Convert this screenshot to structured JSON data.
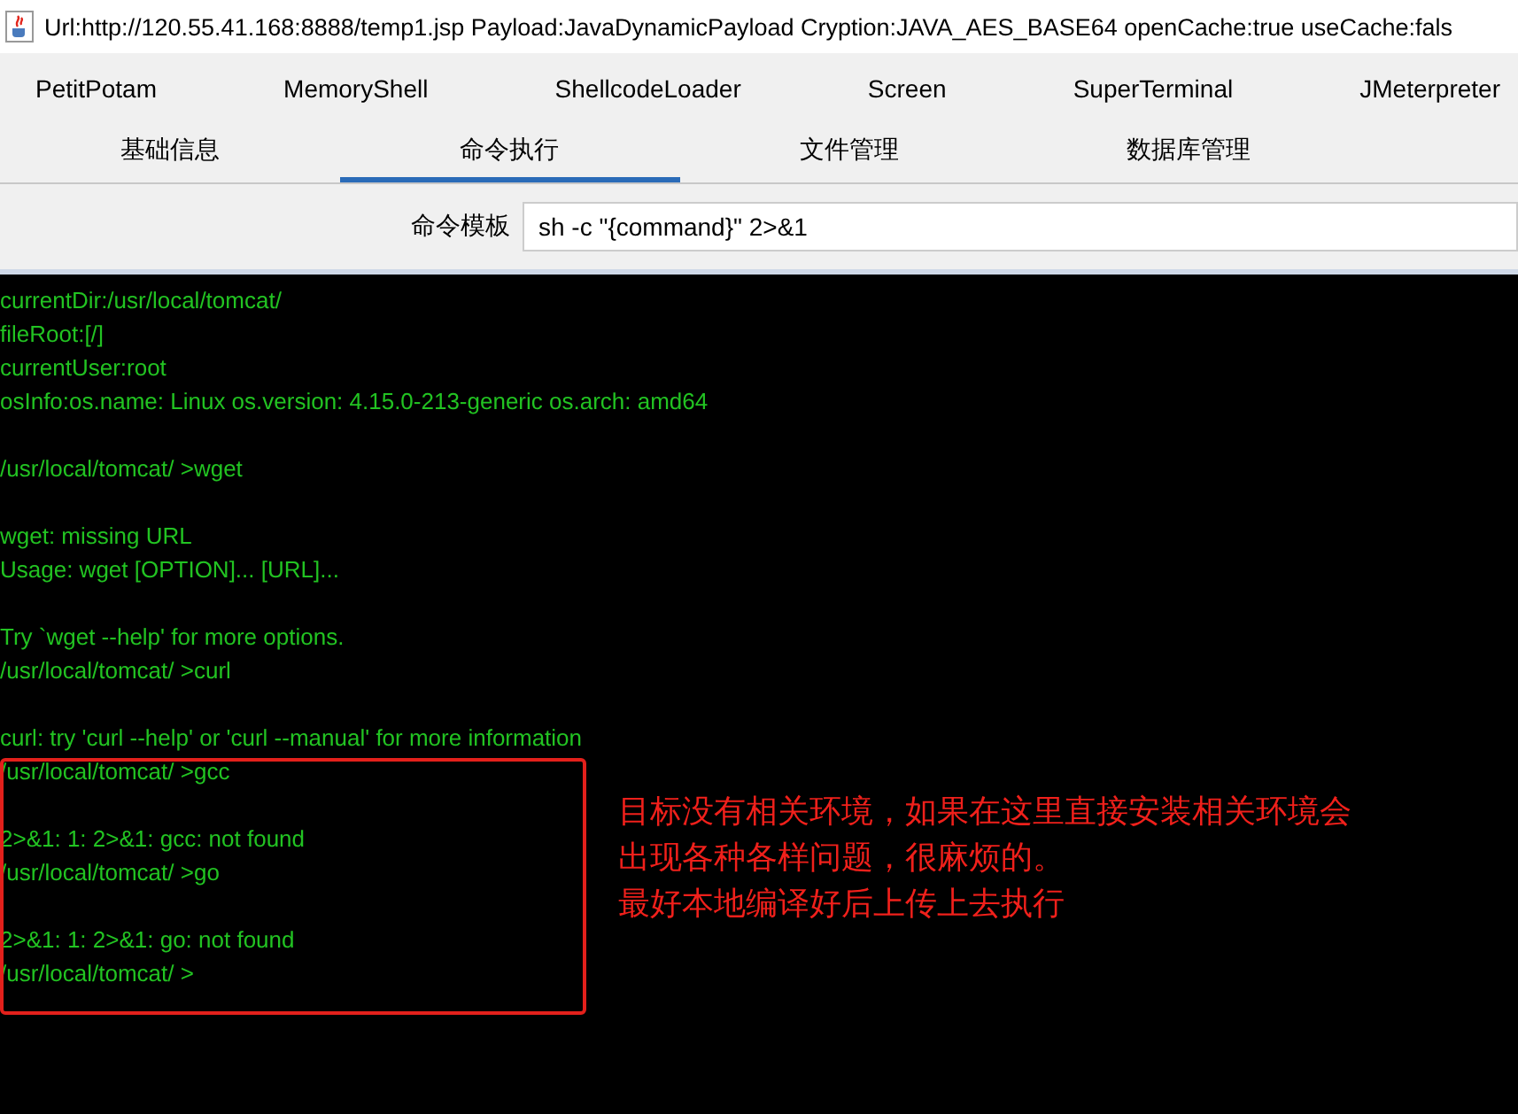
{
  "window": {
    "title": "Url:http://120.55.41.168:8888/temp1.jsp Payload:JavaDynamicPayload Cryption:JAVA_AES_BASE64 openCache:true useCache:fals"
  },
  "plugin_tabs": [
    {
      "label": "PetitPotam"
    },
    {
      "label": "MemoryShell"
    },
    {
      "label": "ShellcodeLoader"
    },
    {
      "label": "Screen"
    },
    {
      "label": "SuperTerminal"
    },
    {
      "label": "JMeterpreter"
    }
  ],
  "tabs": [
    {
      "label": "基础信息",
      "selected": false
    },
    {
      "label": "命令执行",
      "selected": true
    },
    {
      "label": "文件管理",
      "selected": false
    },
    {
      "label": "数据库管理",
      "selected": false
    }
  ],
  "command_template": {
    "label": "命令模板",
    "value": "sh -c \"{command}\" 2>&1"
  },
  "terminal": {
    "blocks": [
      [
        "currentDir:/usr/local/tomcat/",
        "fileRoot:[/]",
        "currentUser:root",
        "osInfo:os.name: Linux os.version: 4.15.0-213-generic os.arch: amd64"
      ],
      [
        "/usr/local/tomcat/ >wget"
      ],
      [
        "wget: missing URL",
        "Usage: wget [OPTION]... [URL]..."
      ],
      [
        "Try `wget --help' for more options.",
        "/usr/local/tomcat/ >curl"
      ],
      [
        "curl: try 'curl --help' or 'curl --manual' for more information",
        "/usr/local/tomcat/ >gcc"
      ],
      [
        "2>&1: 1: 2>&1: gcc: not found",
        "/usr/local/tomcat/ >go"
      ],
      [
        "2>&1: 1: 2>&1: go: not found",
        "/usr/local/tomcat/ >"
      ]
    ]
  },
  "annotation": {
    "lines": [
      "目标没有相关环境，如果在这里直接安装相关环境会",
      "出现各种各样问题，很麻烦的。",
      "最好本地编译好后上传上去执行"
    ]
  }
}
